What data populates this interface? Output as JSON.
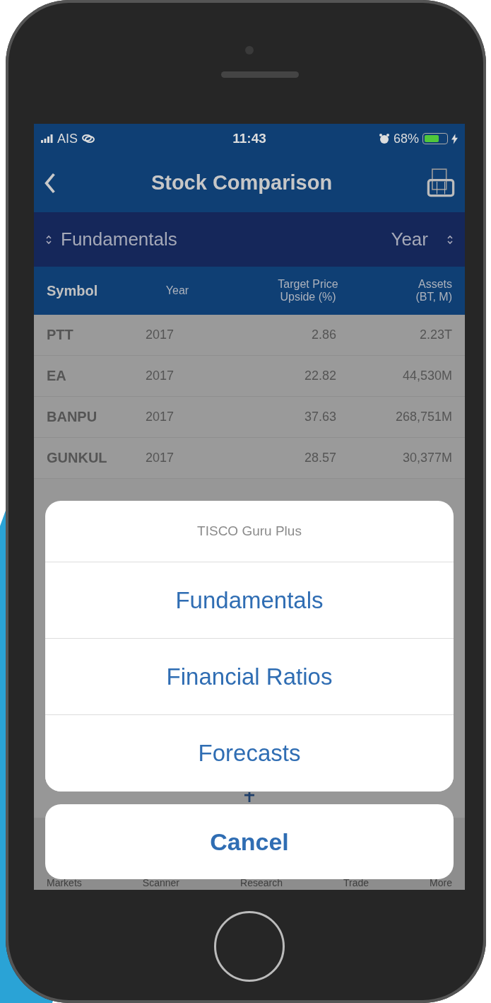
{
  "status_bar": {
    "carrier": "AIS",
    "time": "11:43",
    "battery": "68%"
  },
  "nav": {
    "title": "Stock Comparison"
  },
  "filter_bar": {
    "category": "Fundamentals",
    "period": "Year"
  },
  "table": {
    "columns": [
      "Symbol",
      "Year",
      "Target Price Upside (%)",
      "Assets (BT, M)"
    ],
    "rows": [
      {
        "symbol": "PTT",
        "year": "2017",
        "upside": "2.86",
        "assets": "2.23T"
      },
      {
        "symbol": "EA",
        "year": "2017",
        "upside": "22.82",
        "assets": "44,530M"
      },
      {
        "symbol": "BANPU",
        "year": "2017",
        "upside": "37.63",
        "assets": "268,751M"
      },
      {
        "symbol": "GUNKUL",
        "year": "2017",
        "upside": "28.57",
        "assets": "30,377M"
      }
    ]
  },
  "action_sheet": {
    "title": "TISCO Guru Plus",
    "options": [
      "Fundamentals",
      "Financial Ratios",
      "Forecasts"
    ],
    "cancel": "Cancel"
  },
  "tab_bar": [
    "Markets",
    "Scanner",
    "Research",
    "Trade",
    "More"
  ]
}
